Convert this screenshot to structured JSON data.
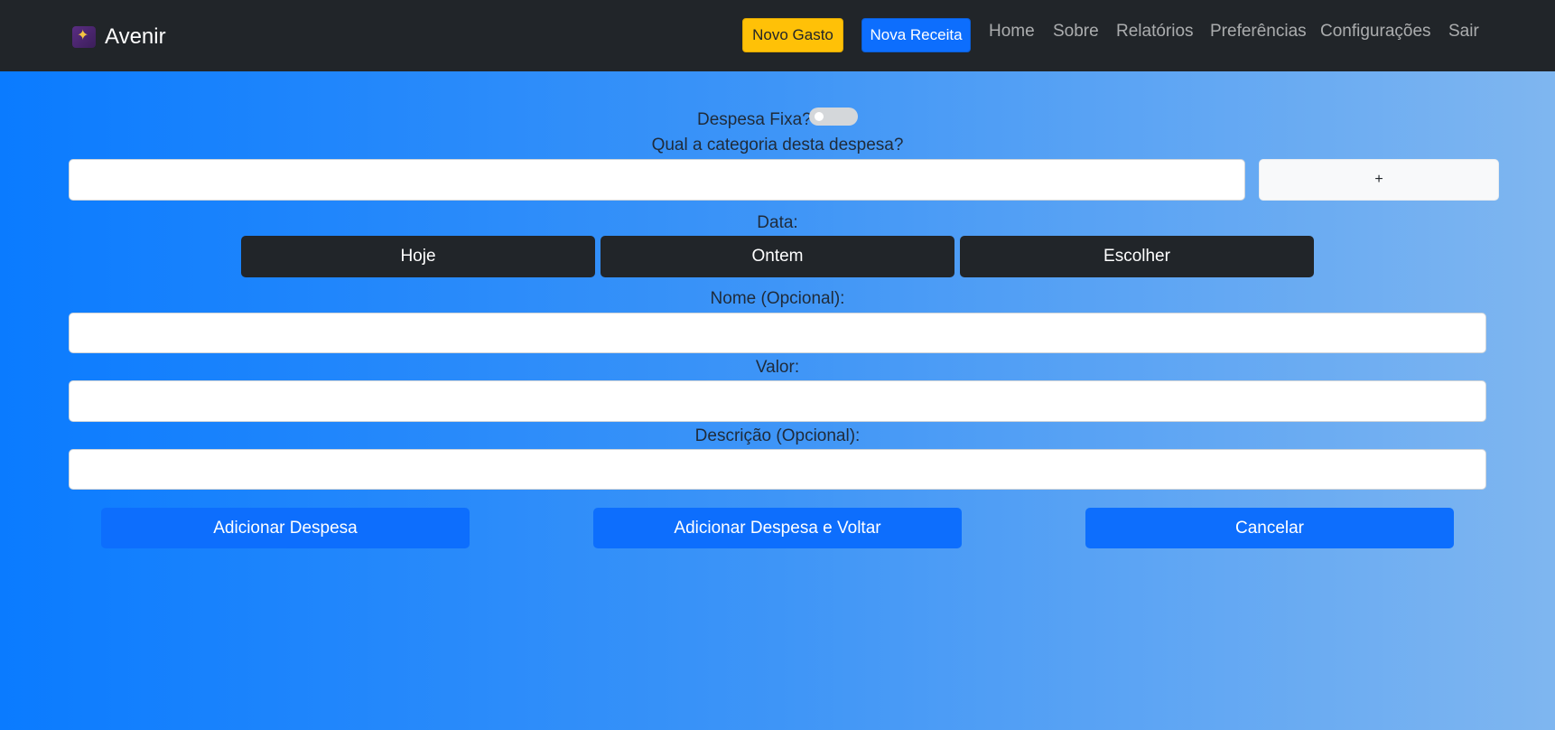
{
  "navbar": {
    "brand": "Avenir",
    "logo_icon": "avenir-logo-icon",
    "buttons": {
      "novo_gasto": "Novo Gasto",
      "nova_receita": "Nova Receita"
    },
    "links": [
      "Home",
      "Sobre",
      "Relatórios",
      "Preferências",
      "Configurações",
      "Sair"
    ]
  },
  "form": {
    "fixed_expense_label": "Despesa Fixa?",
    "fixed_expense_on": false,
    "category_label": "Qual a categoria desta despesa?",
    "category_value": "",
    "add_category_label": "+",
    "date_label": "Data:",
    "date_buttons": [
      "Hoje",
      "Ontem",
      "Escolher"
    ],
    "name_label": "Nome (Opcional):",
    "name_value": "",
    "value_label": "Valor:",
    "value_value": "",
    "description_label": "Descrição (Opcional):",
    "description_value": ""
  },
  "actions": {
    "add": "Adicionar Despesa",
    "add_and_back": "Adicionar Despesa e Voltar",
    "cancel": "Cancelar"
  },
  "colors": {
    "navbar_bg": "#212529",
    "primary": "#0d6efd",
    "warning": "#ffc107",
    "dark_button": "#212529",
    "gradient_start": "#0a7bff",
    "gradient_end": "#7fb6f0"
  }
}
